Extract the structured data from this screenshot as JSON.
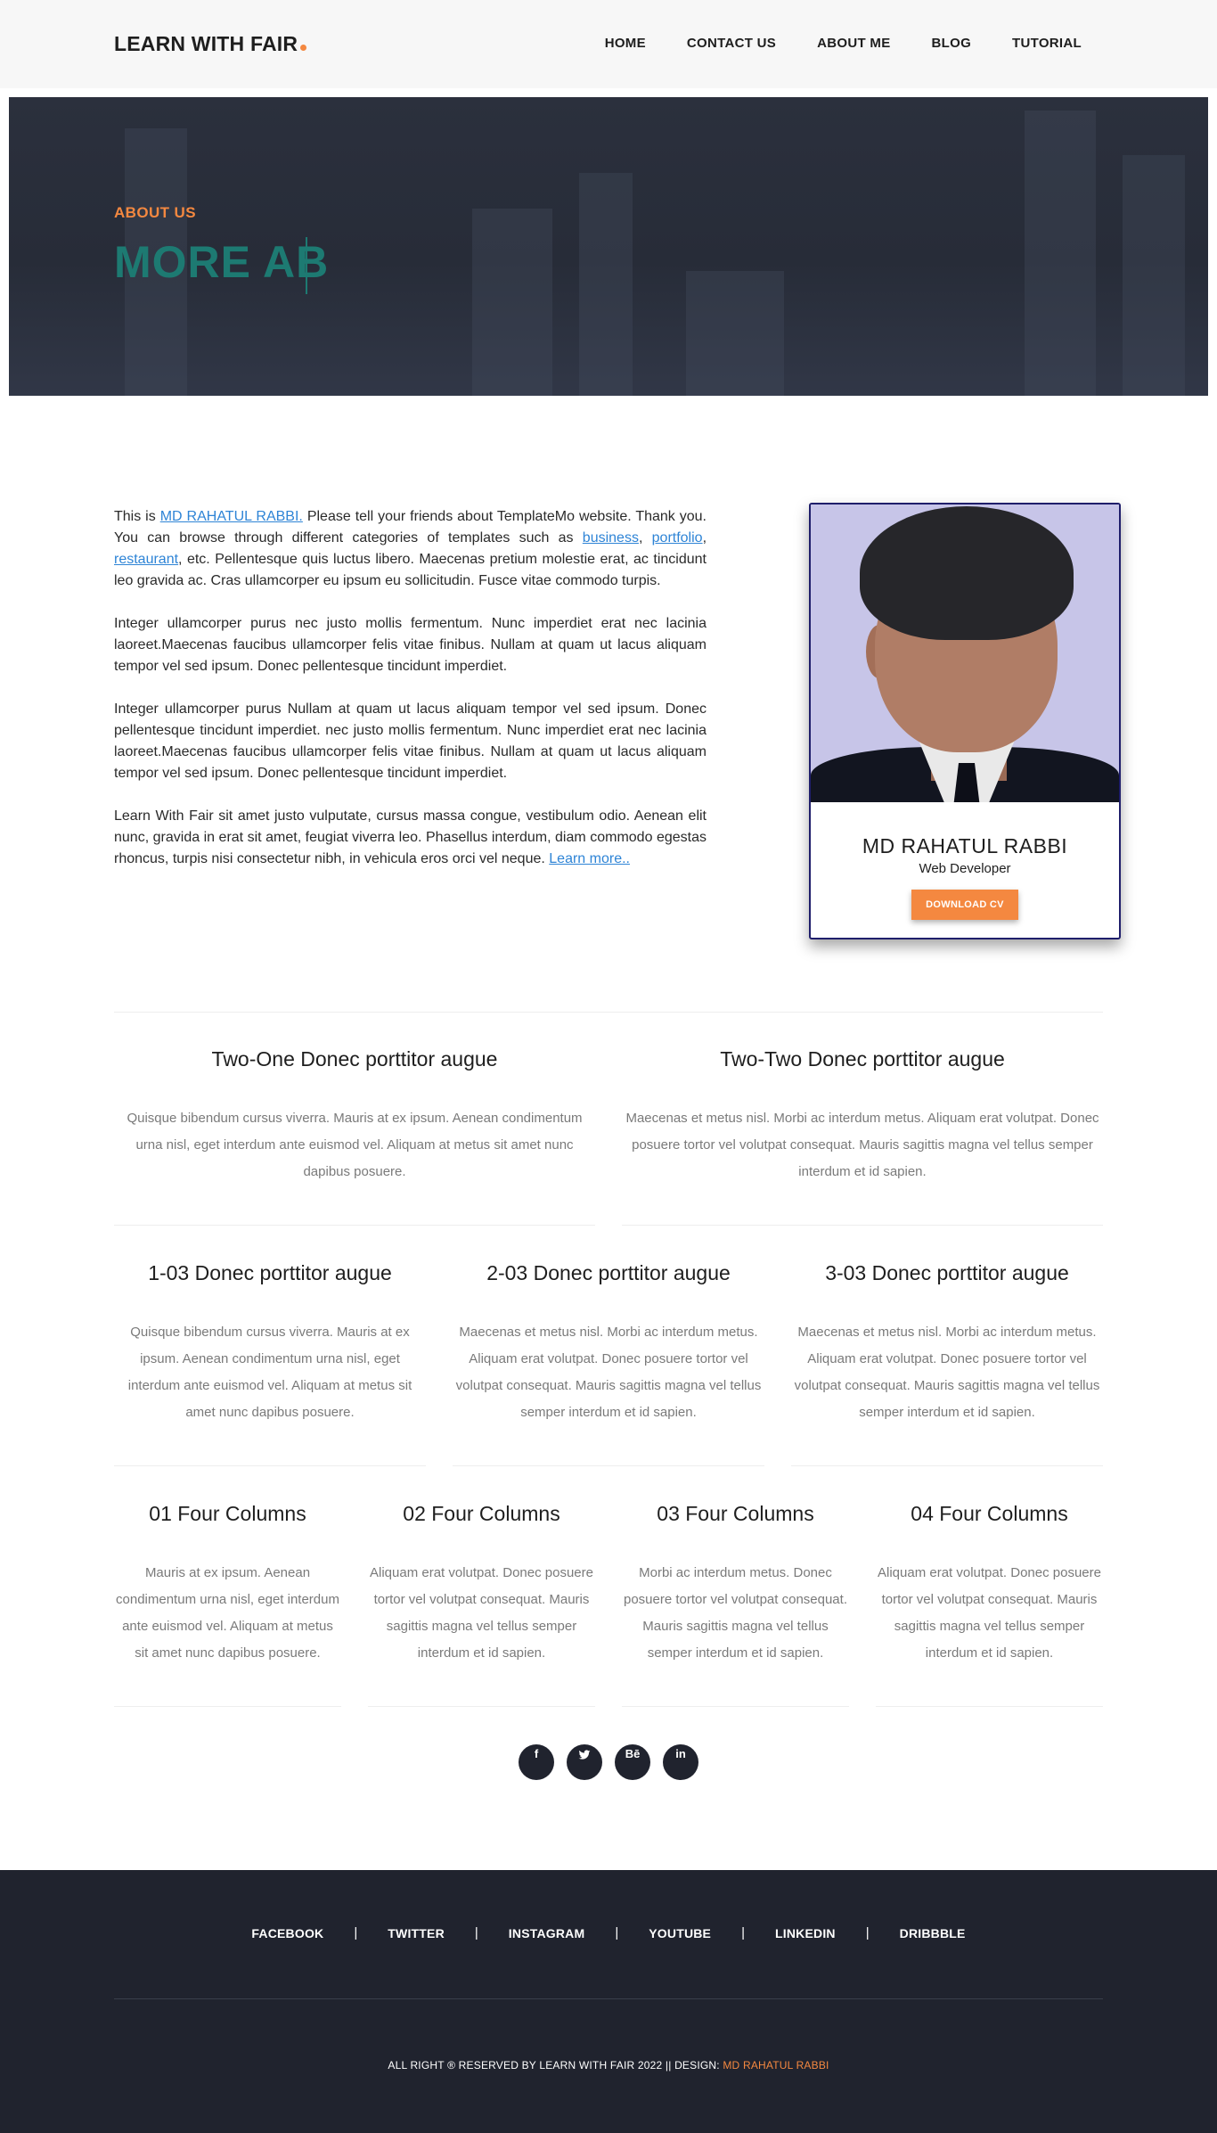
{
  "header": {
    "logo": "LEARN WITH FAIR",
    "nav": [
      {
        "label": "HOME"
      },
      {
        "label": "CONTACT US"
      },
      {
        "label": "ABOUT ME"
      },
      {
        "label": "BLOG"
      },
      {
        "label": "TUTORIAL"
      }
    ]
  },
  "hero": {
    "subtitle": "ABOUT US",
    "title": "MORE AB"
  },
  "about": {
    "p1_start": "This is ",
    "p1_name": "MD RAHATUL RABBI.",
    "p1_mid": " Please tell your friends about TemplateMo website. Thank you. You can browse through different categories of templates such as ",
    "p1_link1": "business",
    "p1_comma": ", ",
    "p1_link2": "portfolio",
    "p1_comma2": ", ",
    "p1_link3": "restaurant",
    "p1_end": ", etc. Pellentesque quis luctus libero. Maecenas pretium molestie erat, ac tincidunt leo gravida ac. Cras ullamcorper eu ipsum eu sollicitudin. Fusce vitae commodo turpis.",
    "p2": "Integer ullamcorper purus nec justo mollis fermentum. Nunc imperdiet erat nec lacinia laoreet.Maecenas faucibus ullamcorper felis vitae finibus. Nullam at quam ut lacus aliquam tempor vel sed ipsum. Donec pellentesque tincidunt imperdiet.",
    "p3": "Integer ullamcorper purus Nullam at quam ut lacus aliquam tempor vel sed ipsum. Donec pellentesque tincidunt imperdiet. nec justo mollis fermentum. Nunc imperdiet erat nec lacinia laoreet.Maecenas faucibus ullamcorper felis vitae finibus. Nullam at quam ut lacus aliquam tempor vel sed ipsum. Donec pellentesque tincidunt imperdiet.",
    "p4": "Learn With Fair sit amet justo vulputate, cursus massa congue, vestibulum odio. Aenean elit nunc, gravida in erat sit amet, feugiat viverra leo. Phasellus interdum, diam commodo egestas rhoncus, turpis nisi consectetur nibh, in vehicula eros orci vel neque. ",
    "p4_link": "Learn more.."
  },
  "profile": {
    "name": "MD RAHATUL RABBI",
    "role": "Web Developer",
    "button": "DOWNLOAD CV"
  },
  "two_cols": [
    {
      "title": "Two-One Donec porttitor augue",
      "text": "Quisque bibendum cursus viverra. Mauris at ex ipsum. Aenean condimentum urna nisl, eget interdum ante euismod vel. Aliquam at metus sit amet nunc dapibus posuere."
    },
    {
      "title": "Two-Two Donec porttitor augue",
      "text": "Maecenas et metus nisl. Morbi ac interdum metus. Aliquam erat volutpat. Donec posuere tortor vel volutpat consequat. Mauris sagittis magna vel tellus semper interdum et id sapien."
    }
  ],
  "three_cols": [
    {
      "title": "1-03 Donec porttitor augue",
      "text": "Quisque bibendum cursus viverra. Mauris at ex ipsum. Aenean condimentum urna nisl, eget interdum ante euismod vel. Aliquam at metus sit amet nunc dapibus posuere."
    },
    {
      "title": "2-03 Donec porttitor augue",
      "text": "Maecenas et metus nisl. Morbi ac interdum metus. Aliquam erat volutpat. Donec posuere tortor vel volutpat consequat. Mauris sagittis magna vel tellus semper interdum et id sapien."
    },
    {
      "title": "3-03 Donec porttitor augue",
      "text": "Maecenas et metus nisl. Morbi ac interdum metus. Aliquam erat volutpat. Donec posuere tortor vel volutpat consequat. Mauris sagittis magna vel tellus semper interdum et id sapien."
    }
  ],
  "four_cols": [
    {
      "title": "01 Four Columns",
      "text": "Mauris at ex ipsum. Aenean condimentum urna nisl, eget interdum ante euismod vel. Aliquam at metus sit amet nunc dapibus posuere."
    },
    {
      "title": "02 Four Columns",
      "text": "Aliquam erat volutpat. Donec posuere tortor vel volutpat consequat. Mauris sagittis magna vel tellus semper interdum et id sapien."
    },
    {
      "title": "03 Four Columns",
      "text": "Morbi ac interdum metus. Donec posuere tortor vel volutpat consequat. Mauris sagittis magna vel tellus semper interdum et id sapien."
    },
    {
      "title": "04 Four Columns",
      "text": "Aliquam erat volutpat. Donec posuere tortor vel volutpat consequat. Mauris sagittis magna vel tellus semper interdum et id sapien."
    }
  ],
  "social": [
    {
      "icon": "facebook-icon",
      "glyph": "f"
    },
    {
      "icon": "twitter-icon",
      "glyph": "♥"
    },
    {
      "icon": "behance-icon",
      "glyph": "Bē"
    },
    {
      "icon": "linkedin-icon",
      "glyph": "in"
    }
  ],
  "footer": {
    "links": [
      {
        "label": "FACEBOOK"
      },
      {
        "label": "TWITTER"
      },
      {
        "label": "INSTAGRAM"
      },
      {
        "label": "YOUTUBE"
      },
      {
        "label": "LINKEDIN"
      },
      {
        "label": "DRIBBBLE"
      }
    ],
    "separator": "|",
    "copyright": "ALL RIGHT ® RESERVED BY LEARN WITH FAIR 2022 || DESIGN: ",
    "designer": "MD RAHATUL RABBI"
  },
  "colors": {
    "accent": "#f48840",
    "link": "#2e84d6",
    "hero_title": "#1d7a72",
    "footer_bg": "#20232e",
    "card_border": "#1f1e6b"
  }
}
